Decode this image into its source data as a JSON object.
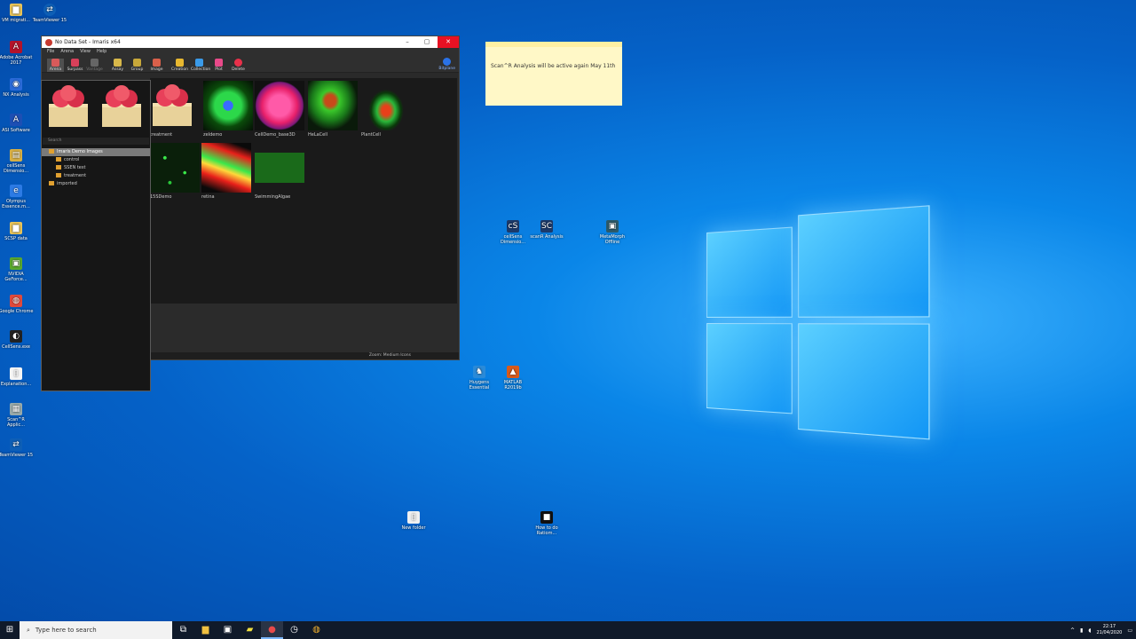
{
  "desktop": {
    "icons_left": [
      {
        "label": "VM migrati...",
        "glyph": "▆",
        "color": "#e8c45a"
      },
      {
        "label": "Adobe Acrobat 2017",
        "glyph": "A",
        "color": "#b3132b"
      },
      {
        "label": "NX Analysis",
        "glyph": "◉",
        "color": "#2a6ad8"
      },
      {
        "label": "ASI Software",
        "glyph": "A",
        "color": "#1d4fb4"
      },
      {
        "label": "cellSens Dimensio...",
        "glyph": "▤",
        "color": "#d8b045"
      },
      {
        "label": "Olympus Essence.m...",
        "glyph": "e",
        "color": "#2c7be5"
      },
      {
        "label": "SCSP data",
        "glyph": "▆",
        "color": "#e8c45a"
      },
      {
        "label": "NVIDIA GeForce...",
        "glyph": "▣",
        "color": "#5aa82e"
      },
      {
        "label": "Google Chrome",
        "glyph": "◍",
        "color": "#e04a3c"
      },
      {
        "label": "CellSens.exe",
        "glyph": "◐",
        "color": "#222"
      },
      {
        "label": "Explanation...",
        "glyph": "▯",
        "color": "#f5f5f5"
      },
      {
        "label": "Scan^R Applic...",
        "glyph": "▦",
        "color": "#9aa"
      },
      {
        "label": "TeamViewer 15",
        "glyph": "⇄",
        "color": "#0e5fb6"
      }
    ],
    "icon_top_second": {
      "label": "TeamViewer 15",
      "glyph": "⇄",
      "color": "#0e5fb6"
    },
    "icons_mid": [
      {
        "label": "cellSens Dimensio...",
        "glyph": "cS",
        "color": "#1c3a6a"
      },
      {
        "label": "scanR Analysis",
        "glyph": "SC",
        "color": "#1c3a6a"
      },
      {
        "label": "MetaMorph Offline",
        "glyph": "▣",
        "color": "#2c5a6a"
      },
      {
        "label": "Huygens Essential",
        "glyph": "♞",
        "color": "#2a8ad8"
      },
      {
        "label": "MATLAB R2019b",
        "glyph": "▲",
        "color": "#d95a1a"
      },
      {
        "label": "New folder",
        "glyph": "▯",
        "color": "#f0f0f0"
      },
      {
        "label": "How to do Ratiom...",
        "glyph": "■",
        "color": "#111"
      }
    ]
  },
  "sticky": {
    "text": "Scan^R Analysis will be active again May 11th"
  },
  "imaris": {
    "title": "No Data Set - Imaris x64",
    "menu": [
      "File",
      "Arena",
      "View",
      "Help"
    ],
    "tools": [
      "Arena",
      "Surpass",
      "Vantage",
      "Assay",
      "Group",
      "Image",
      "Creation",
      "Collection",
      "Plot",
      "Delete"
    ],
    "bitplane": "Bitplane",
    "thumbs": [
      {
        "caption": "treatment"
      },
      {
        "caption": "zeldemo"
      },
      {
        "caption": "CellDemo_base3D"
      },
      {
        "caption": "HeLaCell"
      },
      {
        "caption": "PlantCell"
      },
      {
        "caption": "15SDemo"
      },
      {
        "caption": "retina"
      },
      {
        "caption": "SwimmingAlgae"
      }
    ],
    "zoom": "Zoom: Medium Icons",
    "search_placeholder": "Search",
    "tree": [
      {
        "label": "Imaris Demo Images",
        "selected": true
      },
      {
        "label": "control",
        "selected": false
      },
      {
        "label": "SSEN test",
        "selected": false
      },
      {
        "label": "treatment",
        "selected": false
      },
      {
        "label": "imported",
        "selected": false
      }
    ]
  },
  "taskbar": {
    "search_placeholder": "Type here to search",
    "time": "22:17",
    "date": "21/04/2020"
  }
}
